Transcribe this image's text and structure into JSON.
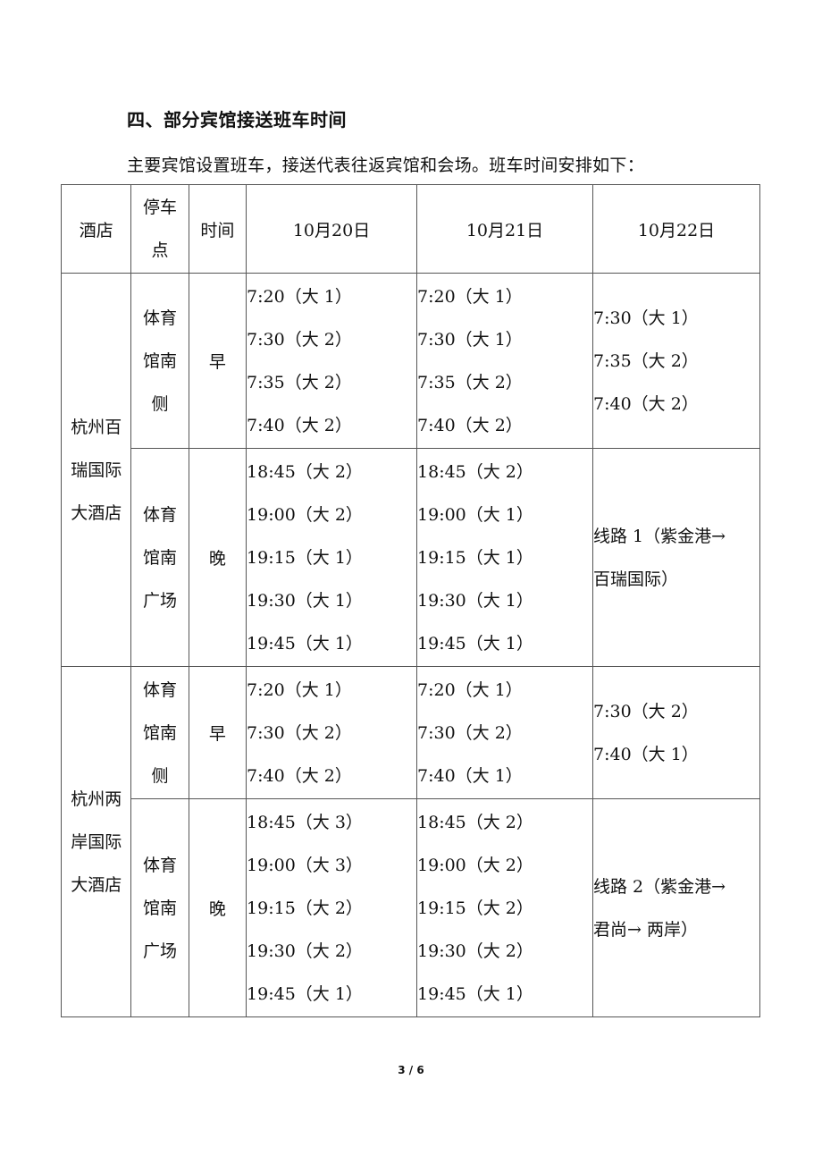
{
  "heading": "四、部分宾馆接送班车时间",
  "intro": "主要宾馆设置班车，接送代表往返宾馆和会场。班车时间安排如下：",
  "table": {
    "headers": {
      "hotel": "酒店",
      "stop_line1": "停车",
      "stop_line2": "点",
      "time": "时间",
      "day1": "10月20日",
      "day2": "10月21日",
      "day3": "10月22日"
    },
    "hotels": [
      {
        "name_lines": [
          "杭州百",
          "瑞国际",
          "大酒店"
        ],
        "morning": {
          "stop_lines": [
            "体育",
            "馆南",
            "侧"
          ],
          "period": "早",
          "day1": [
            "7:20（大 1）",
            "7:30（大 2）",
            "7:35（大 2）",
            "7:40（大 2）"
          ],
          "day2": [
            "7:20（大 1）",
            "7:30（大 1）",
            "7:35（大 2）",
            "7:40（大 2）"
          ],
          "day3": [
            "7:30（大 1）",
            "7:35（大 2）",
            "7:40（大 2）"
          ]
        },
        "evening": {
          "stop_lines": [
            "体育",
            "馆南",
            "广场"
          ],
          "period": "晚",
          "day1": [
            "18:45（大 2）",
            "19:00（大 2）",
            "19:15（大 1）",
            "19:30（大 1）",
            "19:45（大 1）"
          ],
          "day2": [
            "18:45（大 2）",
            "19:00（大 1）",
            "19:15（大 1）",
            "19:30（大 1）",
            "19:45（大 1）"
          ],
          "day3_route_lines": [
            "线路 1（紫金港→",
            "百瑞国际）"
          ]
        }
      },
      {
        "name_lines": [
          "杭州两",
          "岸国际",
          "大酒店"
        ],
        "morning": {
          "stop_lines": [
            "体育",
            "馆南",
            "侧"
          ],
          "period": "早",
          "day1": [
            "7:20（大 1）",
            "7:30（大 2）",
            "7:40（大 2）"
          ],
          "day2": [
            "7:20（大 1）",
            "7:30（大 2）",
            "7:40（大 1）"
          ],
          "day3": [
            "7:30（大 2）",
            "7:40（大 1）"
          ]
        },
        "evening": {
          "stop_lines": [
            "体育",
            "馆南",
            "广场"
          ],
          "period": "晚",
          "day1": [
            "18:45（大 3）",
            "19:00（大 3）",
            "19:15（大 2）",
            "19:30（大 2）",
            "19:45（大 1）"
          ],
          "day2": [
            "18:45（大 2）",
            "19:00（大 2）",
            "19:15（大 2）",
            "19:30（大 2）",
            "19:45（大 1）"
          ],
          "day3_route_lines": [
            "线路 2（紫金港→",
            "君尚→ 两岸）"
          ]
        }
      }
    ]
  },
  "footer": {
    "page_indicator": "3 / 6"
  }
}
